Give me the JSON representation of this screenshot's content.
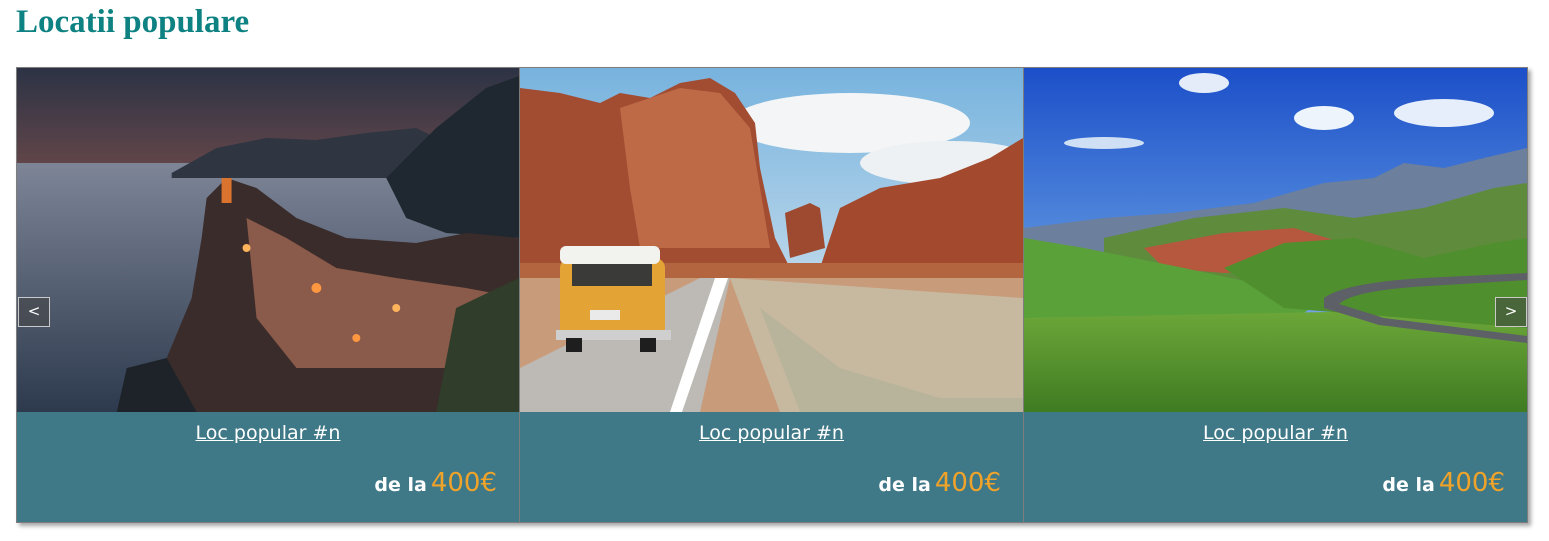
{
  "section": {
    "title": "Locatii populare"
  },
  "carousel": {
    "prev_label": "<",
    "next_label": ">",
    "cards": [
      {
        "link": "Loc popular #n",
        "price_prefix": "de la",
        "price": "400€",
        "image_icon": "coastal-village-sunset-photo"
      },
      {
        "link": "Loc popular #n",
        "price_prefix": "de la",
        "price": "400€",
        "image_icon": "desert-road-van-photo"
      },
      {
        "link": "Loc popular #n",
        "price_prefix": "de la",
        "price": "400€",
        "image_icon": "green-mountain-valley-photo"
      }
    ]
  },
  "colors": {
    "title": "#0e8282",
    "card_background": "#3f7886",
    "price_accent": "#f0a32a",
    "link_text": "#ffffff"
  }
}
